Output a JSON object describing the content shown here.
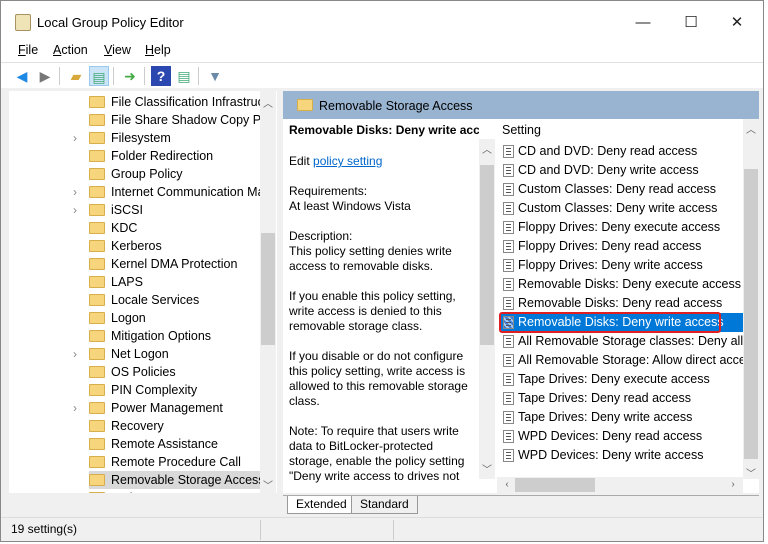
{
  "window": {
    "title": "Local Group Policy Editor",
    "minimize": "—",
    "maximize": "☐",
    "close": "✕"
  },
  "menu": [
    {
      "label": "File",
      "key": "F",
      "rest": "ile"
    },
    {
      "label": "Action",
      "key": "A",
      "rest": "ction"
    },
    {
      "label": "View",
      "key": "V",
      "rest": "iew"
    },
    {
      "label": "Help",
      "key": "H",
      "rest": "elp"
    }
  ],
  "toolbar": {
    "icons": [
      "back-arrow",
      "forward-arrow",
      "up-folder",
      "show-hide-console-tree",
      "export-list",
      "help",
      "show-hide-action-pane",
      "filter"
    ]
  },
  "tree": {
    "items": [
      {
        "label": "File Classification Infrastructure",
        "expandable": false
      },
      {
        "label": "File Share Shadow Copy Provider",
        "expandable": false
      },
      {
        "label": "Filesystem",
        "expandable": true
      },
      {
        "label": "Folder Redirection",
        "expandable": false
      },
      {
        "label": "Group Policy",
        "expandable": false
      },
      {
        "label": "Internet Communication Management",
        "expandable": true
      },
      {
        "label": "iSCSI",
        "expandable": true
      },
      {
        "label": "KDC",
        "expandable": false
      },
      {
        "label": "Kerberos",
        "expandable": false
      },
      {
        "label": "Kernel DMA Protection",
        "expandable": false
      },
      {
        "label": "LAPS",
        "expandable": false
      },
      {
        "label": "Locale Services",
        "expandable": false
      },
      {
        "label": "Logon",
        "expandable": false
      },
      {
        "label": "Mitigation Options",
        "expandable": false
      },
      {
        "label": "Net Logon",
        "expandable": true
      },
      {
        "label": "OS Policies",
        "expandable": false
      },
      {
        "label": "PIN Complexity",
        "expandable": false
      },
      {
        "label": "Power Management",
        "expandable": true
      },
      {
        "label": "Recovery",
        "expandable": false
      },
      {
        "label": "Remote Assistance",
        "expandable": false
      },
      {
        "label": "Remote Procedure Call",
        "expandable": false
      },
      {
        "label": "Removable Storage Access",
        "expandable": false,
        "selected": true
      },
      {
        "label": "Scripts",
        "expandable": false
      }
    ]
  },
  "right": {
    "header": "Removable Storage Access",
    "desc": {
      "title": "Removable Disks: Deny write access",
      "edit_prefix": "Edit ",
      "edit_link": "policy setting",
      "requirements": "Requirements:",
      "requirements_value": "At least Windows Vista",
      "description_label": "Description:",
      "p1": "This policy setting denies write access to removable disks.",
      "p2": "If you enable this policy setting, write access is denied to this removable storage class.",
      "p3": "If you disable or do not configure this policy setting, write access is allowed to this removable storage class.",
      "p4": "Note: To require that users write data to BitLocker-protected storage, enable the policy setting \"Deny write access to drives not protected by BitLocker.\""
    },
    "list_header": "Setting",
    "settings": [
      "CD and DVD: Deny read access",
      "CD and DVD: Deny write access",
      "Custom Classes: Deny read access",
      "Custom Classes: Deny write access",
      "Floppy Drives: Deny execute access",
      "Floppy Drives: Deny read access",
      "Floppy Drives: Deny write access",
      "Removable Disks: Deny execute access",
      "Removable Disks: Deny read access",
      "Removable Disks: Deny write access",
      "All Removable Storage classes: Deny all access",
      "All Removable Storage: Allow direct access in remote sessions",
      "Tape Drives: Deny execute access",
      "Tape Drives: Deny read access",
      "Tape Drives: Deny write access",
      "WPD Devices: Deny read access",
      "WPD Devices: Deny write access"
    ],
    "selected_index": 9,
    "highlight_color": "#e02020",
    "tabs": [
      "Extended",
      "Standard"
    ],
    "active_tab": "Extended"
  },
  "status": "19 setting(s)"
}
